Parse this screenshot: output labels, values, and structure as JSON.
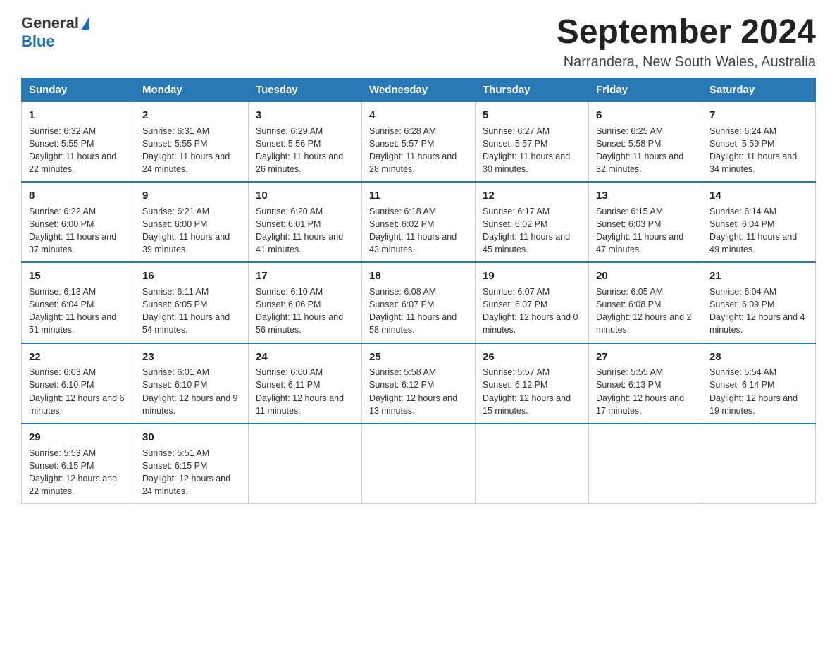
{
  "header": {
    "logo_general": "General",
    "logo_blue": "Blue",
    "month_year": "September 2024",
    "location": "Narrandera, New South Wales, Australia"
  },
  "columns": [
    "Sunday",
    "Monday",
    "Tuesday",
    "Wednesday",
    "Thursday",
    "Friday",
    "Saturday"
  ],
  "weeks": [
    [
      {
        "day": "1",
        "sunrise": "6:32 AM",
        "sunset": "5:55 PM",
        "daylight": "11 hours and 22 minutes."
      },
      {
        "day": "2",
        "sunrise": "6:31 AM",
        "sunset": "5:55 PM",
        "daylight": "11 hours and 24 minutes."
      },
      {
        "day": "3",
        "sunrise": "6:29 AM",
        "sunset": "5:56 PM",
        "daylight": "11 hours and 26 minutes."
      },
      {
        "day": "4",
        "sunrise": "6:28 AM",
        "sunset": "5:57 PM",
        "daylight": "11 hours and 28 minutes."
      },
      {
        "day": "5",
        "sunrise": "6:27 AM",
        "sunset": "5:57 PM",
        "daylight": "11 hours and 30 minutes."
      },
      {
        "day": "6",
        "sunrise": "6:25 AM",
        "sunset": "5:58 PM",
        "daylight": "11 hours and 32 minutes."
      },
      {
        "day": "7",
        "sunrise": "6:24 AM",
        "sunset": "5:59 PM",
        "daylight": "11 hours and 34 minutes."
      }
    ],
    [
      {
        "day": "8",
        "sunrise": "6:22 AM",
        "sunset": "6:00 PM",
        "daylight": "11 hours and 37 minutes."
      },
      {
        "day": "9",
        "sunrise": "6:21 AM",
        "sunset": "6:00 PM",
        "daylight": "11 hours and 39 minutes."
      },
      {
        "day": "10",
        "sunrise": "6:20 AM",
        "sunset": "6:01 PM",
        "daylight": "11 hours and 41 minutes."
      },
      {
        "day": "11",
        "sunrise": "6:18 AM",
        "sunset": "6:02 PM",
        "daylight": "11 hours and 43 minutes."
      },
      {
        "day": "12",
        "sunrise": "6:17 AM",
        "sunset": "6:02 PM",
        "daylight": "11 hours and 45 minutes."
      },
      {
        "day": "13",
        "sunrise": "6:15 AM",
        "sunset": "6:03 PM",
        "daylight": "11 hours and 47 minutes."
      },
      {
        "day": "14",
        "sunrise": "6:14 AM",
        "sunset": "6:04 PM",
        "daylight": "11 hours and 49 minutes."
      }
    ],
    [
      {
        "day": "15",
        "sunrise": "6:13 AM",
        "sunset": "6:04 PM",
        "daylight": "11 hours and 51 minutes."
      },
      {
        "day": "16",
        "sunrise": "6:11 AM",
        "sunset": "6:05 PM",
        "daylight": "11 hours and 54 minutes."
      },
      {
        "day": "17",
        "sunrise": "6:10 AM",
        "sunset": "6:06 PM",
        "daylight": "11 hours and 56 minutes."
      },
      {
        "day": "18",
        "sunrise": "6:08 AM",
        "sunset": "6:07 PM",
        "daylight": "11 hours and 58 minutes."
      },
      {
        "day": "19",
        "sunrise": "6:07 AM",
        "sunset": "6:07 PM",
        "daylight": "12 hours and 0 minutes."
      },
      {
        "day": "20",
        "sunrise": "6:05 AM",
        "sunset": "6:08 PM",
        "daylight": "12 hours and 2 minutes."
      },
      {
        "day": "21",
        "sunrise": "6:04 AM",
        "sunset": "6:09 PM",
        "daylight": "12 hours and 4 minutes."
      }
    ],
    [
      {
        "day": "22",
        "sunrise": "6:03 AM",
        "sunset": "6:10 PM",
        "daylight": "12 hours and 6 minutes."
      },
      {
        "day": "23",
        "sunrise": "6:01 AM",
        "sunset": "6:10 PM",
        "daylight": "12 hours and 9 minutes."
      },
      {
        "day": "24",
        "sunrise": "6:00 AM",
        "sunset": "6:11 PM",
        "daylight": "12 hours and 11 minutes."
      },
      {
        "day": "25",
        "sunrise": "5:58 AM",
        "sunset": "6:12 PM",
        "daylight": "12 hours and 13 minutes."
      },
      {
        "day": "26",
        "sunrise": "5:57 AM",
        "sunset": "6:12 PM",
        "daylight": "12 hours and 15 minutes."
      },
      {
        "day": "27",
        "sunrise": "5:55 AM",
        "sunset": "6:13 PM",
        "daylight": "12 hours and 17 minutes."
      },
      {
        "day": "28",
        "sunrise": "5:54 AM",
        "sunset": "6:14 PM",
        "daylight": "12 hours and 19 minutes."
      }
    ],
    [
      {
        "day": "29",
        "sunrise": "5:53 AM",
        "sunset": "6:15 PM",
        "daylight": "12 hours and 22 minutes."
      },
      {
        "day": "30",
        "sunrise": "5:51 AM",
        "sunset": "6:15 PM",
        "daylight": "12 hours and 24 minutes."
      },
      null,
      null,
      null,
      null,
      null
    ]
  ]
}
